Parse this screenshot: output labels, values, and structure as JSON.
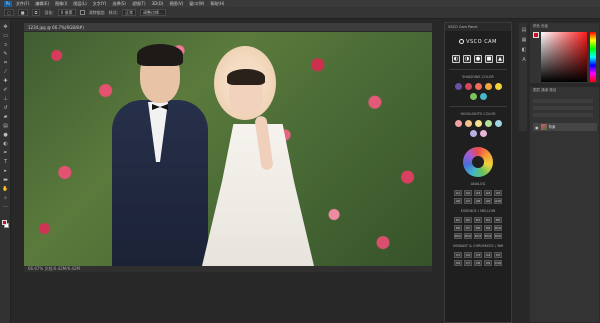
{
  "menubar": {
    "logo": "Ps",
    "items": [
      "文件(F)",
      "编辑(E)",
      "图像(I)",
      "图层(L)",
      "文字(Y)",
      "选择(S)",
      "滤镜(T)",
      "3D(D)",
      "视图(V)",
      "窗口(W)",
      "帮助(H)"
    ]
  },
  "optionsbar": {
    "feather_label": "羽化:",
    "feather_value": "0 像素",
    "antialias_label": "消除锯齿",
    "style_label": "样式:",
    "style_value": "正常",
    "refine_label": "调整边缘..."
  },
  "document": {
    "tab_title": "1234.jpg @ 66.7%(RGB/8#)",
    "status_zoom": "66.67%",
    "status_doc": "文档:6.42M/6.42M"
  },
  "vsco_panel": {
    "title": "VSCO Cam Panel",
    "brand": "VSCO CAM",
    "shadows_title": "SHADOWS COLOR",
    "highlights_title": "HIGHLIGHTS COLOR",
    "swatch_colors": [
      "#6b4fa3",
      "#d6455a",
      "#f06b5a",
      "#f3a63c",
      "#f2d23b",
      "#7fc35a",
      "#49b7c6"
    ],
    "highlight_colors": [
      "#f2a0a5",
      "#f3c08a",
      "#f3df8e",
      "#b3df9c",
      "#9fd6e0",
      "#b8aee8",
      "#e8b5d6"
    ],
    "analog_title": "ANALOG",
    "analog_buttons": [
      "A1",
      "A2",
      "A3",
      "A4",
      "A5",
      "A6",
      "A7",
      "A8",
      "A9",
      "A10"
    ],
    "essence_title": "ESSENCE / MELLOW",
    "essence_buttons": [
      "E1",
      "E2",
      "E3",
      "E4",
      "E5",
      "E6",
      "E7",
      "E8",
      "E9",
      "E10",
      "E11",
      "E12",
      "E13",
      "E14",
      "E15"
    ],
    "vibrant_title": "VIBRANT & CHROMATIC / BW",
    "vibrant_buttons": [
      "C1",
      "C2",
      "C3",
      "C4",
      "C5",
      "C6",
      "C7",
      "C8",
      "C9",
      "C10"
    ]
  },
  "right_dock": {
    "color_tab": "颜色  色板",
    "layers_tab": "图层  通道  路径",
    "layer_name": "背景",
    "fg_color": "#c8102e"
  }
}
